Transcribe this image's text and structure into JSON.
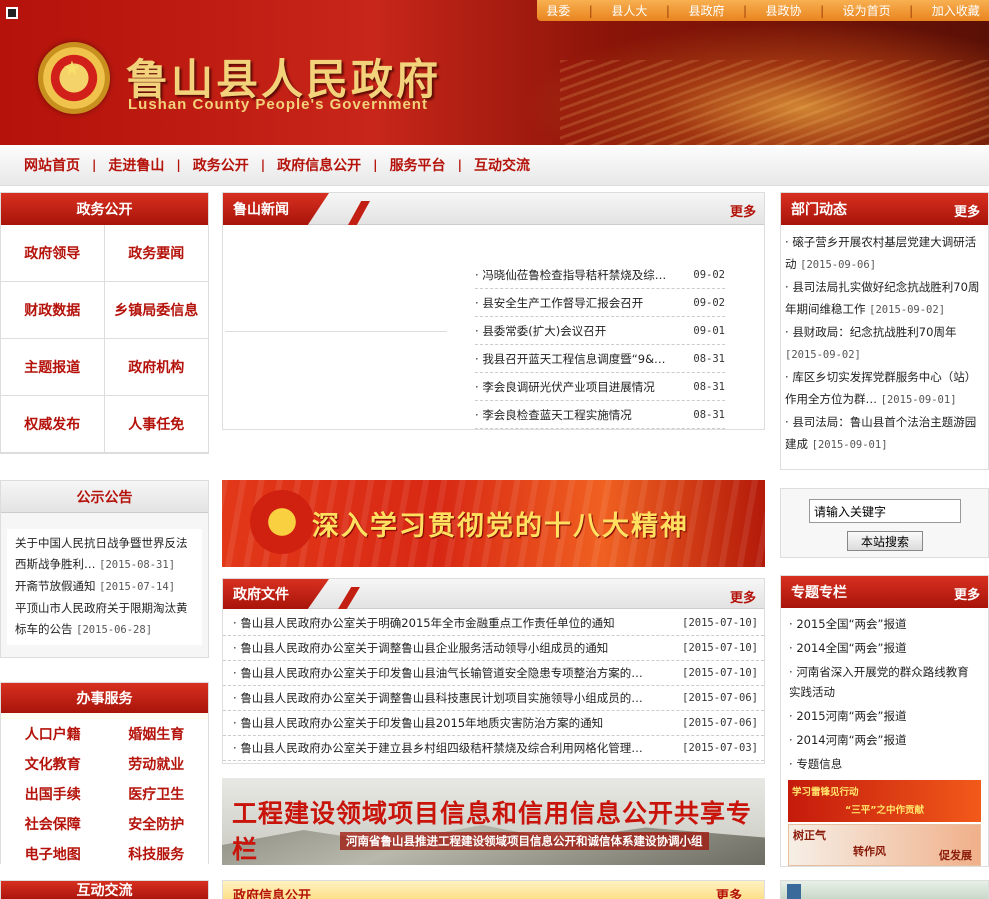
{
  "header": {
    "title": "鲁山县人民政府",
    "subtitle": "Lushan County People's Government",
    "top_links": [
      "县委",
      "县人大",
      "县政府",
      "县政协",
      "设为首页",
      "加入收藏"
    ]
  },
  "nav": [
    "网站首页",
    "走进鲁山",
    "政务公开",
    "政府信息公开",
    "服务平台",
    "互动交流"
  ],
  "gov_affairs": {
    "title": "政务公开",
    "items": [
      "政府领导",
      "政务要闻",
      "财政数据",
      "乡镇局委信息",
      "主题报道",
      "政府机构",
      "权威发布",
      "人事任免"
    ]
  },
  "notices": {
    "title": "公示公告",
    "items": [
      {
        "text": "关于中国人民抗日战争暨世界反法西斯战争胜利…",
        "date": "[2015-08-31]"
      },
      {
        "text": "开斋节放假通知",
        "date": "[2015-07-14]"
      },
      {
        "text": "平顶山市人民政府关于限期淘汰黄标车的公告",
        "date": "[2015-06-28]"
      }
    ]
  },
  "services": {
    "title": "办事服务",
    "items": [
      "人口户籍",
      "婚姻生育",
      "文化教育",
      "劳动就业",
      "出国手续",
      "医疗卫生",
      "社会保障",
      "安全防护",
      "电子地图",
      "科技服务"
    ]
  },
  "interactive": {
    "title": "互动交流"
  },
  "news": {
    "title": "鲁山新闻",
    "more": "更多",
    "items": [
      {
        "text": "冯晓仙莅鲁检查指导秸秆禁烧及综…",
        "date": "09-02"
      },
      {
        "text": "县安全生产工作督导汇报会召开",
        "date": "09-02"
      },
      {
        "text": "县委常委(扩大)会议召开",
        "date": "09-01"
      },
      {
        "text": "我县召开蓝天工程信息调度暨“9&…",
        "date": "08-31"
      },
      {
        "text": "李会良调研光伏产业项目进展情况",
        "date": "08-31"
      },
      {
        "text": "李会良检查蓝天工程实施情况",
        "date": "08-31"
      }
    ]
  },
  "banner_party": "深入学习贯彻党的十八大精神",
  "gov_docs": {
    "title": "政府文件",
    "more": "更多",
    "items": [
      {
        "text": "鲁山县人民政府办公室关于明确2015年全市金融重点工作责任单位的通知",
        "date": "[2015-07-10]"
      },
      {
        "text": "鲁山县人民政府办公室关于调整鲁山县企业服务活动领导小组成员的通知",
        "date": "[2015-07-10]"
      },
      {
        "text": "鲁山县人民政府办公室关于印发鲁山县油气长输管道安全隐患专项整治方案的…",
        "date": "[2015-07-10]"
      },
      {
        "text": "鲁山县人民政府办公室关于调整鲁山县科技惠民计划项目实施领导小组成员的…",
        "date": "[2015-07-06]"
      },
      {
        "text": "鲁山县人民政府办公室关于印发鲁山县2015年地质灾害防治方案的通知",
        "date": "[2015-07-06]"
      },
      {
        "text": "鲁山县人民政府办公室关于建立县乡村组四级秸秆禁烧及综合利用网格化管理…",
        "date": "[2015-07-03]"
      }
    ]
  },
  "banner_project": {
    "title": "工程建设领域项目信息和信用信息公开共享专栏",
    "subtitle": "河南省鲁山县推进工程建设领域项目信息公开和诚信体系建设协调小组"
  },
  "gov_info": {
    "title": "政府信息公开",
    "more": "更多"
  },
  "dept": {
    "title": "部门动态",
    "more": "更多",
    "items": [
      {
        "text": "磙子营乡开展农村基层党建大调研活动",
        "date": "[2015-09-06]"
      },
      {
        "text": "县司法局扎实做好纪念抗战胜利70周年期间维稳工作",
        "date": "[2015-09-02]"
      },
      {
        "text": "县财政局：纪念抗战胜利70周年",
        "date": "[2015-09-02]"
      },
      {
        "text": "库区乡切实发挥党群服务中心（站）作用全方位为群…",
        "date": "[2015-09-01]"
      },
      {
        "text": "县司法局：鲁山县首个法治主题游园建成",
        "date": "[2015-09-01]"
      }
    ]
  },
  "search": {
    "placeholder": "请输入关键字",
    "button": "本站搜索"
  },
  "special": {
    "title": "专题专栏",
    "more": "更多",
    "items": [
      "2015全国“两会”报道",
      "2014全国“两会”报道",
      "河南省深入开展党的群众路线教育实践活动",
      "2015河南“两会”报道",
      "2014河南“两会”报道",
      "专题信息"
    ]
  },
  "promo1": {
    "line1": "学习雷锋见行动",
    "line2": "“三平”之中作贡献"
  },
  "promo2": {
    "line1": "树正气",
    "line2": "转作风",
    "line3": "促发展"
  }
}
